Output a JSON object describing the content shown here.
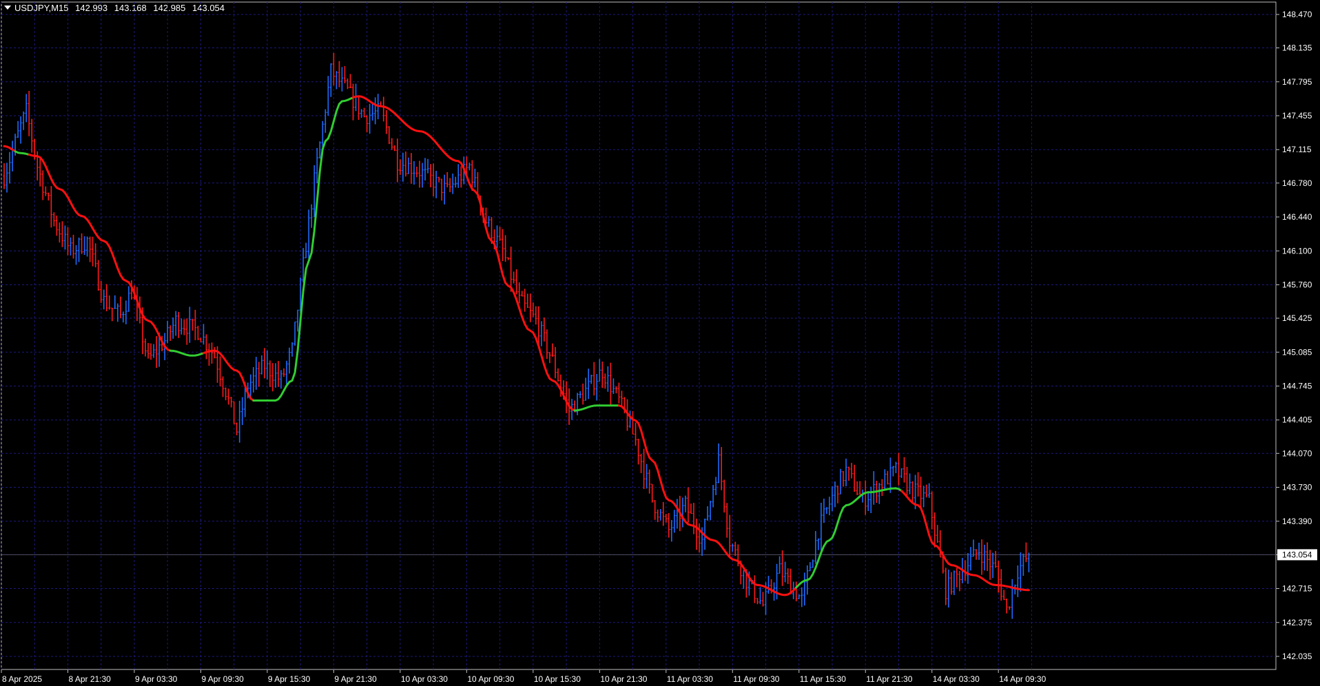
{
  "header": {
    "symbol": "USDJPY,M15",
    "open": "142.993",
    "high": "143.168",
    "low": "142.985",
    "close": "143.054"
  },
  "colors": {
    "background": "#000000",
    "grid": "#1a1a80",
    "bull_bar": "#1e6bff",
    "bear_bar": "#ff1a1a",
    "ma_up": "#32cd32",
    "ma_down": "#ff1010",
    "axis_text": "#ffffff",
    "frame": "#c0c0c0"
  },
  "chart_data": {
    "type": "line",
    "chart_style": "ohlc-bars",
    "title": "USDJPY,M15",
    "ylim": [
      142.035,
      148.47
    ],
    "y_ticks": [
      "148.470",
      "148.135",
      "147.795",
      "147.455",
      "147.115",
      "146.780",
      "146.440",
      "146.100",
      "145.760",
      "145.425",
      "145.085",
      "144.745",
      "144.405",
      "144.070",
      "143.730",
      "143.390",
      "143.054",
      "142.715",
      "142.375",
      "142.035"
    ],
    "current_price": "143.054",
    "x_ticks": [
      "8 Apr 2025",
      "8 Apr 21:30",
      "9 Apr 03:30",
      "9 Apr 09:30",
      "9 Apr 15:30",
      "9 Apr 21:30",
      "10 Apr 03:30",
      "10 Apr 09:30",
      "10 Apr 15:30",
      "10 Apr 21:30",
      "11 Apr 03:30",
      "11 Apr 09:30",
      "11 Apr 15:30",
      "11 Apr 21:30",
      "14 Apr 03:30",
      "14 Apr 09:30"
    ],
    "bars_per_label": 24,
    "price_path_keypoints": [
      [
        0,
        146.85
      ],
      [
        6,
        147.35
      ],
      [
        8,
        147.5
      ],
      [
        12,
        146.95
      ],
      [
        18,
        146.4
      ],
      [
        24,
        146.1
      ],
      [
        30,
        146.2
      ],
      [
        36,
        145.6
      ],
      [
        42,
        145.45
      ],
      [
        46,
        145.7
      ],
      [
        52,
        145.0
      ],
      [
        58,
        145.2
      ],
      [
        62,
        145.4
      ],
      [
        70,
        145.3
      ],
      [
        76,
        145.05
      ],
      [
        80,
        144.7
      ],
      [
        84,
        144.3
      ],
      [
        88,
        144.75
      ],
      [
        94,
        144.95
      ],
      [
        100,
        144.8
      ],
      [
        104,
        145.1
      ],
      [
        112,
        146.8
      ],
      [
        118,
        147.9
      ],
      [
        124,
        147.7
      ],
      [
        130,
        147.45
      ],
      [
        136,
        147.5
      ],
      [
        142,
        147.0
      ],
      [
        150,
        146.9
      ],
      [
        160,
        146.7
      ],
      [
        168,
        146.95
      ],
      [
        174,
        146.4
      ],
      [
        180,
        146.1
      ],
      [
        186,
        145.6
      ],
      [
        192,
        145.4
      ],
      [
        198,
        145.0
      ],
      [
        204,
        144.5
      ],
      [
        210,
        144.7
      ],
      [
        216,
        144.9
      ],
      [
        222,
        144.6
      ],
      [
        228,
        144.2
      ],
      [
        234,
        143.6
      ],
      [
        240,
        143.3
      ],
      [
        246,
        143.55
      ],
      [
        252,
        143.2
      ],
      [
        258,
        144.0
      ],
      [
        262,
        143.2
      ],
      [
        268,
        142.8
      ],
      [
        274,
        142.55
      ],
      [
        280,
        142.9
      ],
      [
        288,
        142.6
      ],
      [
        294,
        143.3
      ],
      [
        300,
        143.7
      ],
      [
        304,
        143.9
      ],
      [
        310,
        143.6
      ],
      [
        316,
        143.75
      ],
      [
        322,
        143.9
      ],
      [
        328,
        143.7
      ],
      [
        334,
        143.6
      ],
      [
        340,
        142.7
      ],
      [
        346,
        142.9
      ],
      [
        352,
        143.1
      ],
      [
        358,
        142.9
      ],
      [
        362,
        142.5
      ],
      [
        366,
        142.9
      ],
      [
        370,
        143.05
      ]
    ],
    "ma_keypoints": [
      [
        0,
        147.15
      ],
      [
        6,
        147.08
      ],
      [
        12,
        147.05
      ],
      [
        20,
        146.72
      ],
      [
        28,
        146.45
      ],
      [
        36,
        146.2
      ],
      [
        44,
        145.8
      ],
      [
        52,
        145.4
      ],
      [
        60,
        145.1
      ],
      [
        68,
        145.05
      ],
      [
        76,
        145.1
      ],
      [
        84,
        144.9
      ],
      [
        90,
        144.6
      ],
      [
        98,
        144.6
      ],
      [
        104,
        144.8
      ],
      [
        110,
        146.0
      ],
      [
        116,
        147.2
      ],
      [
        122,
        147.6
      ],
      [
        128,
        147.65
      ],
      [
        136,
        147.55
      ],
      [
        150,
        147.3
      ],
      [
        164,
        147.0
      ],
      [
        170,
        146.7
      ],
      [
        176,
        146.2
      ],
      [
        182,
        145.75
      ],
      [
        190,
        145.3
      ],
      [
        198,
        144.8
      ],
      [
        206,
        144.5
      ],
      [
        214,
        144.55
      ],
      [
        222,
        144.55
      ],
      [
        228,
        144.4
      ],
      [
        234,
        144.0
      ],
      [
        240,
        143.6
      ],
      [
        248,
        143.35
      ],
      [
        256,
        143.2
      ],
      [
        264,
        143.0
      ],
      [
        272,
        142.75
      ],
      [
        282,
        142.65
      ],
      [
        290,
        142.8
      ],
      [
        298,
        143.2
      ],
      [
        304,
        143.55
      ],
      [
        312,
        143.68
      ],
      [
        322,
        143.72
      ],
      [
        330,
        143.55
      ],
      [
        336,
        143.15
      ],
      [
        342,
        142.95
      ],
      [
        350,
        142.85
      ],
      [
        358,
        142.75
      ],
      [
        370,
        142.7
      ]
    ],
    "ma_trend_segments": [
      {
        "from": 0,
        "to": 4,
        "trend": "down"
      },
      {
        "from": 4,
        "to": 9,
        "trend": "up"
      },
      {
        "from": 9,
        "to": 60,
        "trend": "down"
      },
      {
        "from": 60,
        "to": 72,
        "trend": "up"
      },
      {
        "from": 72,
        "to": 90,
        "trend": "down"
      },
      {
        "from": 90,
        "to": 126,
        "trend": "up"
      },
      {
        "from": 126,
        "to": 206,
        "trend": "down"
      },
      {
        "from": 206,
        "to": 222,
        "trend": "up"
      },
      {
        "from": 222,
        "to": 280,
        "trend": "down"
      },
      {
        "from": 280,
        "to": 286,
        "trend": "flat"
      },
      {
        "from": 286,
        "to": 324,
        "trend": "up"
      },
      {
        "from": 324,
        "to": 370,
        "trend": "down"
      }
    ],
    "grid": true
  }
}
